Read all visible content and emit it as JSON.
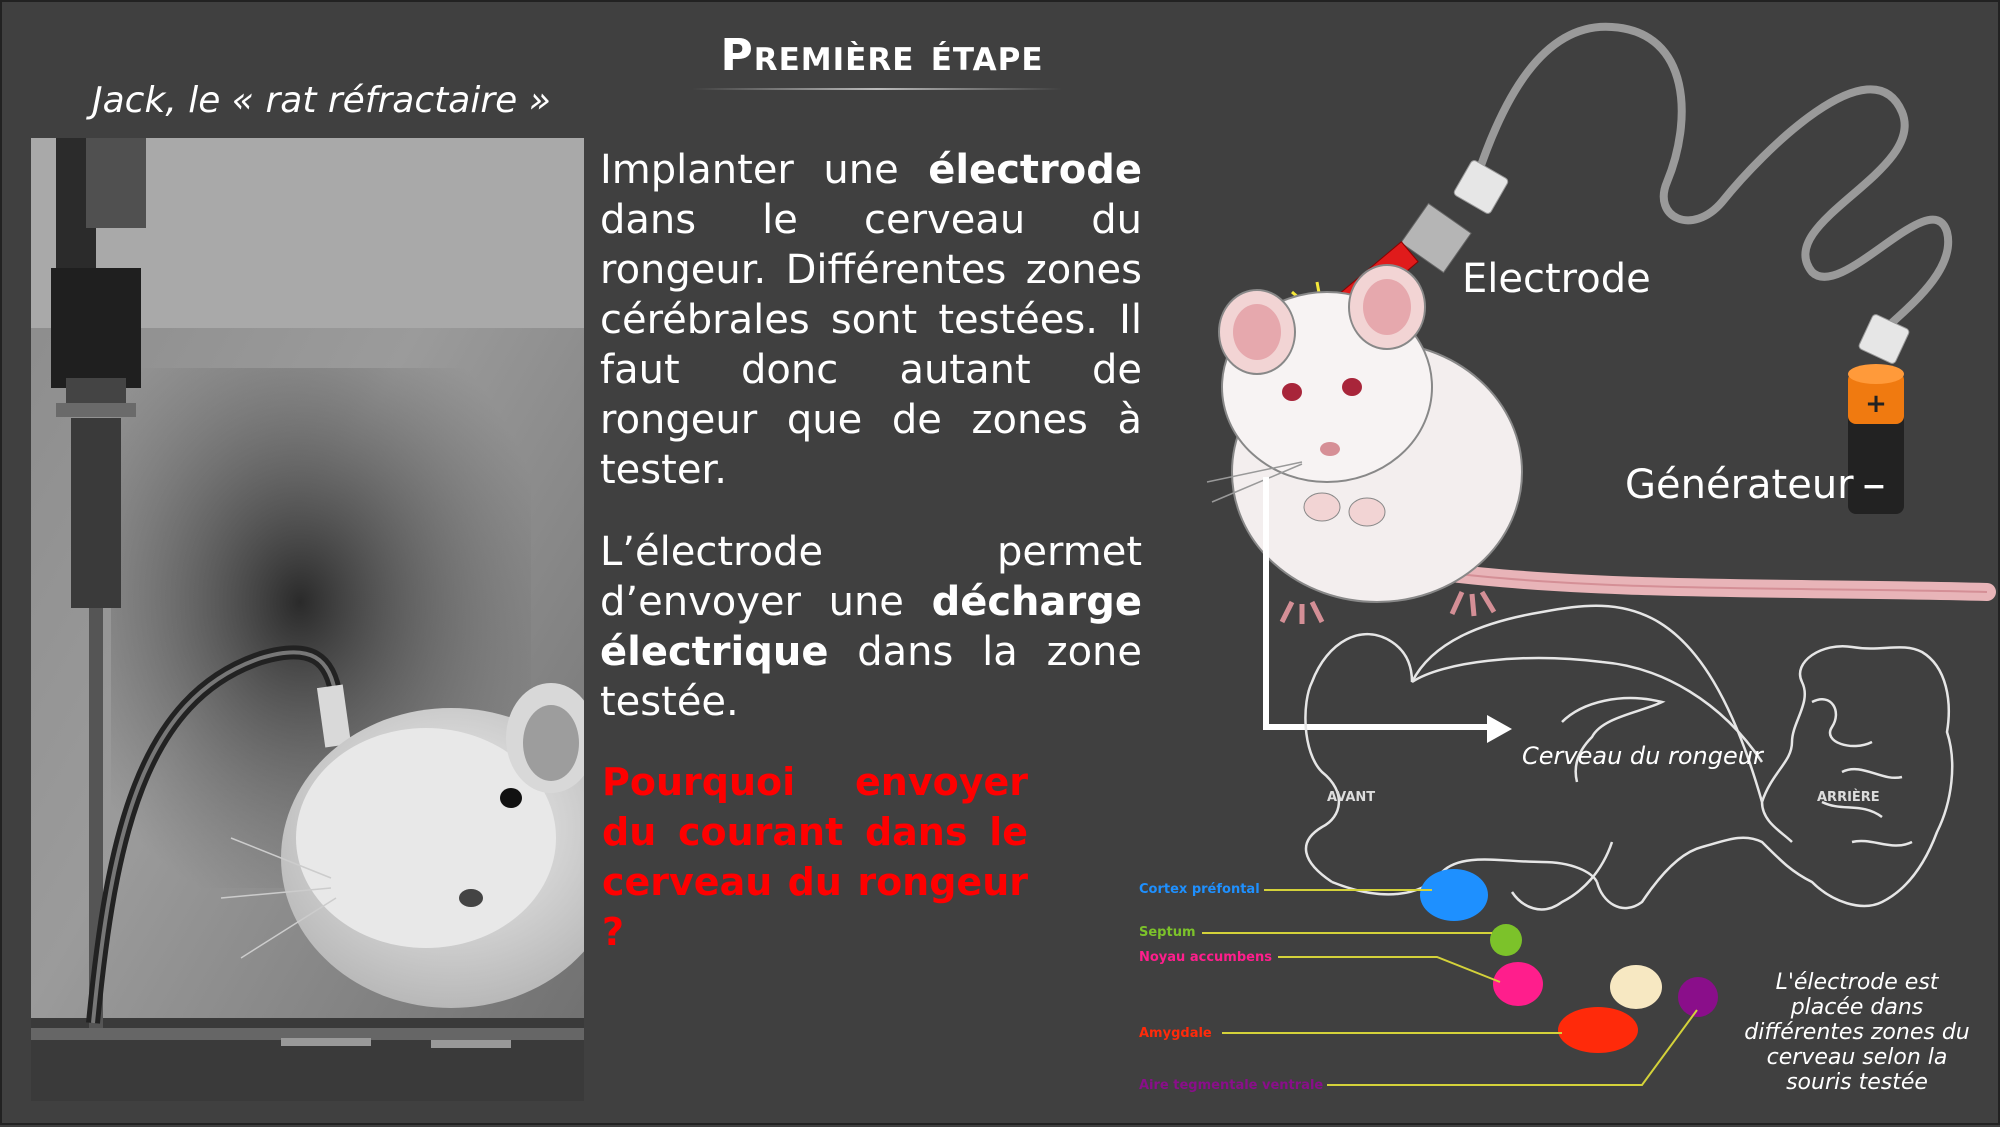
{
  "slide": {
    "title": "Première étape",
    "photo_caption": "Jack, le « rat réfractaire »",
    "paragraph1": {
      "t1": "Implanter une ",
      "b1": "électrode",
      "t2": " dans le cerveau du rongeur. Différentes zones cérébrales sont testées. Il faut donc autant de rongeur que de zones à tester."
    },
    "paragraph2": {
      "t1": "L’électrode permet d’envoyer une ",
      "b1": "décharge électrique",
      "t2": " dans la zone testée."
    },
    "question": "Pourquoi envoyer du courant dans le cerveau du rongeur ?"
  },
  "diagram": {
    "electrode_label": "Electrode",
    "generator_label": "Générateur",
    "battery_plus": "+",
    "battery_minus": "−",
    "brain_caption": "Cerveau du rongeur",
    "front_label": "AVANT",
    "back_label": "ARRIÈRE",
    "regions": [
      {
        "name": "Cortex préfontal",
        "color": "#1e90ff"
      },
      {
        "name": "Septum",
        "color": "#7cc22a"
      },
      {
        "name": "Noyau accumbens",
        "color": "#ff1e8c"
      },
      {
        "name": "Amygdale",
        "color": "#ff2a0a"
      },
      {
        "name": "Aire tegmentale ventrale",
        "color": "#8a0e8a"
      }
    ],
    "note": "L'électrode est placée dans différentes zones du cerveau selon la souris testée"
  }
}
